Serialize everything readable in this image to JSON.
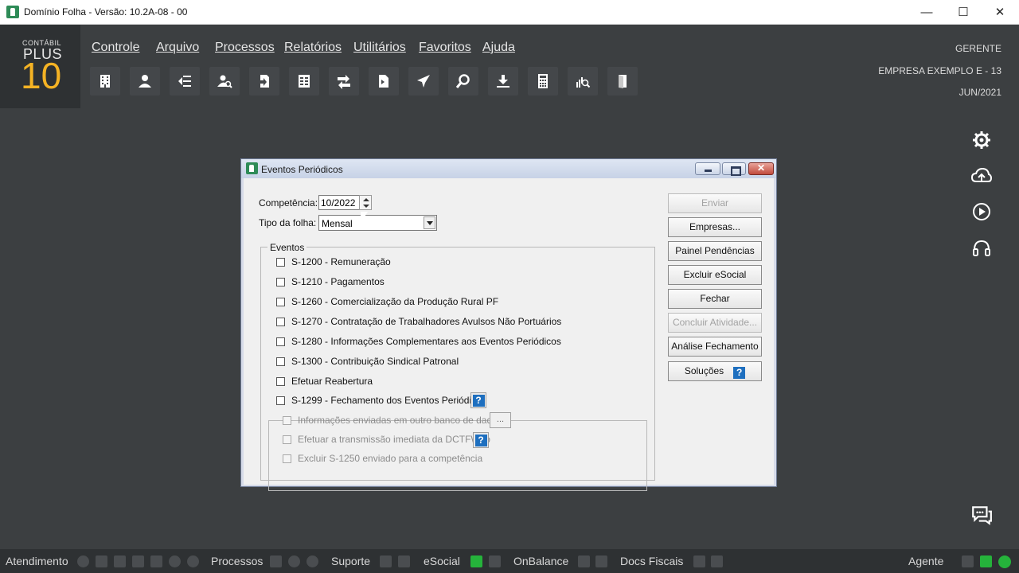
{
  "window": {
    "title": "Domínio Folha - Versão: 10.2A-08 - 00",
    "controls": [
      "minimize",
      "maximize",
      "close"
    ]
  },
  "logo": {
    "line1": "CONTÁBIL",
    "line2": "PLUS",
    "line3": "10",
    "accent_color": "#f5b324"
  },
  "menu": {
    "items": [
      "Controle",
      "Arquivo",
      "Processos",
      "Relatórios",
      "Utilitários",
      "Favoritos",
      "Ajuda"
    ]
  },
  "toolbar": {
    "icons": [
      "building-icon",
      "person-icon",
      "exchange-icon",
      "user-search-icon",
      "document-arrow-icon",
      "calculator-list-icon",
      "transfer-icon",
      "file-swap-icon",
      "airplane-icon",
      "search-icon",
      "download-icon",
      "calculator-icon",
      "chart-search-icon",
      "door-icon"
    ]
  },
  "user_info": {
    "role": "GERENTE",
    "company": "EMPRESA EXEMPLO E    - 13",
    "period": "JUN/2021"
  },
  "side_icons": [
    "gear-icon",
    "cloud-upload-icon",
    "play-icon",
    "headset-icon"
  ],
  "dialog": {
    "title": "Eventos Periódicos",
    "competencia_label": "Competência:",
    "competencia_value": "10/2022",
    "tipo_label": "Tipo da folha:",
    "tipo_value": "Mensal",
    "eventos_legend": "Eventos",
    "events": [
      "S-1200 - Remuneração",
      "S-1210 - Pagamentos",
      "S-1260 - Comercialização da Produção Rural PF",
      "S-1270 - Contratação de Trabalhadores Avulsos Não Portuários",
      "S-1280 - Informações Complementares aos Eventos Periódicos",
      "S-1300 - Contribuição Sindical Patronal",
      "Efetuar Reabertura",
      "S-1299 - Fechamento dos Eventos Periódicos"
    ],
    "sub_options": [
      "Informações enviadas em outro banco de dados",
      "Efetuar a transmissão imediata da DCTFWeb",
      "Excluir S-1250 enviado para a competência"
    ],
    "ellipsis": "...",
    "help_glyph": "?",
    "buttons": {
      "enviar": "Enviar",
      "empresas": "Empresas...",
      "painel": "Painel Pendências",
      "excluir": "Excluir eSocial",
      "fechar": "Fechar",
      "concluir": "Concluir Atividade...",
      "analise": "Análise Fechamento",
      "solucoes": "Soluções"
    }
  },
  "bottombar": {
    "atendimento": "Atendimento",
    "processos": "Processos",
    "suporte": "Suporte",
    "esocial": "eSocial",
    "onbalance": "OnBalance",
    "docs_fiscais": "Docs Fiscais",
    "agente": "Agente",
    "status_color": "#25b33b"
  }
}
